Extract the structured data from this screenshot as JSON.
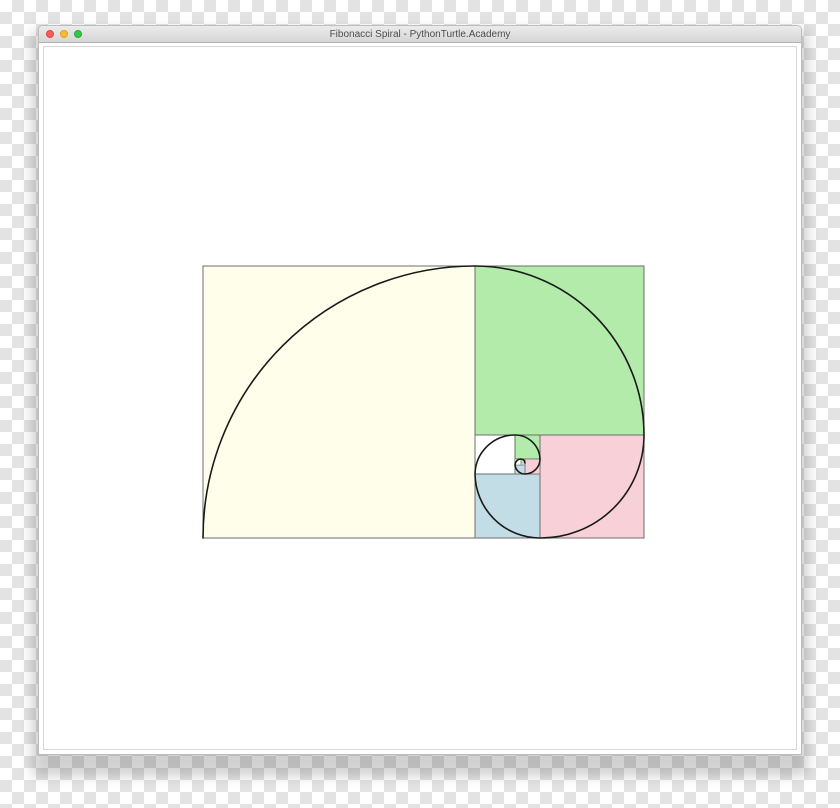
{
  "window": {
    "title": "Fibonacci Spiral - PythonTurtle.Academy"
  },
  "colors": {
    "yellow_square": "#fefeeb",
    "green_square": "#b2ebaa",
    "pink_square": "#f8d0d8",
    "blue_square": "#c3dde6",
    "square_border": "#6e6e6e",
    "spiral": "#1a1a1a",
    "close_button": "#fc5f57",
    "minimize_button": "#fdbc2e",
    "zoom_button": "#34c84a"
  }
}
